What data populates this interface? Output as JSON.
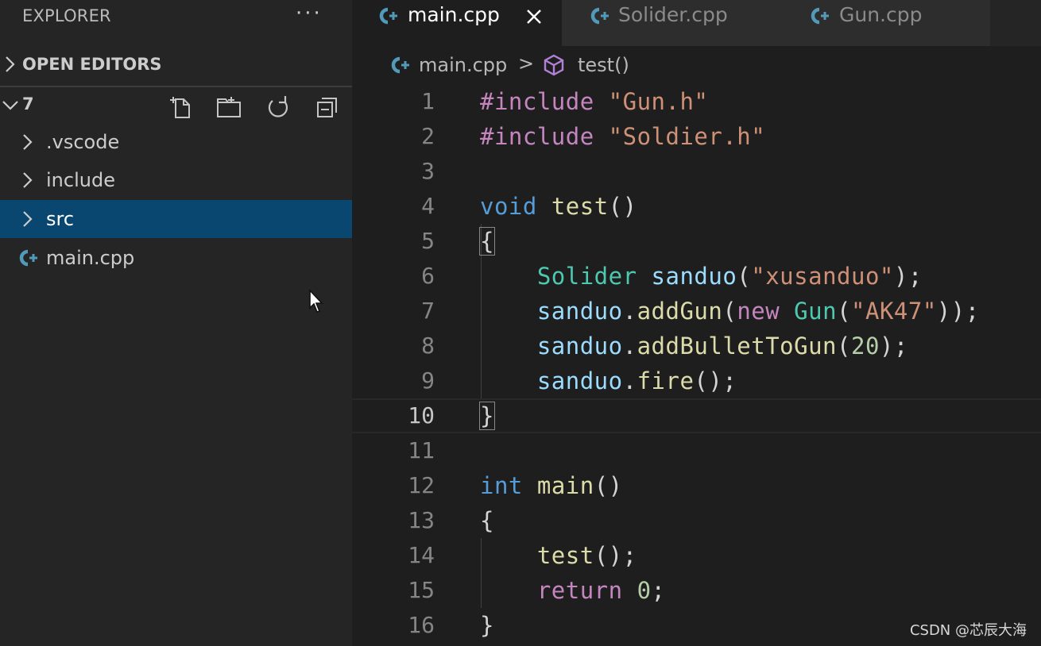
{
  "explorer": {
    "title": "EXPLORER",
    "more_label": "···",
    "open_editors_label": "OPEN EDITORS",
    "folder_name": "7",
    "tree": [
      {
        "label": ".vscode",
        "kind": "folder",
        "selected": false
      },
      {
        "label": "include",
        "kind": "folder",
        "selected": false
      },
      {
        "label": "src",
        "kind": "folder",
        "selected": true
      },
      {
        "label": "main.cpp",
        "kind": "file",
        "selected": false
      }
    ],
    "toolbar_icons": [
      "new-file-icon",
      "new-folder-icon",
      "refresh-icon",
      "collapse-all-icon"
    ]
  },
  "tabs": [
    {
      "label": "main.cpp",
      "active": true,
      "icon": "cpp-file-icon"
    },
    {
      "label": "Solider.cpp",
      "active": false,
      "icon": "cpp-file-icon"
    },
    {
      "label": "Gun.cpp",
      "active": false,
      "icon": "cpp-file-icon"
    }
  ],
  "breadcrumb": {
    "file": "main.cpp",
    "separator": ">",
    "symbol": "test()"
  },
  "editor": {
    "current_line": 10,
    "line_numbers": [
      "1",
      "2",
      "3",
      "4",
      "5",
      "6",
      "7",
      "8",
      "9",
      "10",
      "11",
      "12",
      "13",
      "14",
      "15",
      "16"
    ],
    "lines": [
      [
        [
          "pre",
          "#include"
        ],
        [
          "pun",
          " "
        ],
        [
          "str",
          "\"Gun.h\""
        ]
      ],
      [
        [
          "pre",
          "#include"
        ],
        [
          "pun",
          " "
        ],
        [
          "str",
          "\"Soldier.h\""
        ]
      ],
      [],
      [
        [
          "type",
          "void"
        ],
        [
          "pun",
          " "
        ],
        [
          "fn",
          "test"
        ],
        [
          "pun",
          "()"
        ]
      ],
      [
        [
          "bm",
          "{"
        ]
      ],
      [
        [
          "pun",
          "    "
        ],
        [
          "cls",
          "Solider"
        ],
        [
          "pun",
          " "
        ],
        [
          "var",
          "sanduo"
        ],
        [
          "pun",
          "("
        ],
        [
          "str",
          "\"xusanduo\""
        ],
        [
          "pun",
          ");"
        ]
      ],
      [
        [
          "pun",
          "    "
        ],
        [
          "var",
          "sanduo"
        ],
        [
          "pun",
          "."
        ],
        [
          "fn",
          "addGun"
        ],
        [
          "pun",
          "("
        ],
        [
          "ctl",
          "new"
        ],
        [
          "pun",
          " "
        ],
        [
          "cls",
          "Gun"
        ],
        [
          "pun",
          "("
        ],
        [
          "str",
          "\"AK47\""
        ],
        [
          "pun",
          "));"
        ]
      ],
      [
        [
          "pun",
          "    "
        ],
        [
          "var",
          "sanduo"
        ],
        [
          "pun",
          "."
        ],
        [
          "fn",
          "addBulletToGun"
        ],
        [
          "pun",
          "("
        ],
        [
          "num",
          "20"
        ],
        [
          "pun",
          ");"
        ]
      ],
      [
        [
          "pun",
          "    "
        ],
        [
          "var",
          "sanduo"
        ],
        [
          "pun",
          "."
        ],
        [
          "fn",
          "fire"
        ],
        [
          "pun",
          "();"
        ]
      ],
      [
        [
          "bm",
          "}"
        ]
      ],
      [],
      [
        [
          "type",
          "int"
        ],
        [
          "pun",
          " "
        ],
        [
          "fn",
          "main"
        ],
        [
          "pun",
          "()"
        ]
      ],
      [
        [
          "pun",
          "{"
        ]
      ],
      [
        [
          "pun",
          "    "
        ],
        [
          "fn",
          "test"
        ],
        [
          "pun",
          "();"
        ]
      ],
      [
        [
          "pun",
          "    "
        ],
        [
          "ctl",
          "return"
        ],
        [
          "pun",
          " "
        ],
        [
          "num",
          "0"
        ],
        [
          "pun",
          ";"
        ]
      ],
      [
        [
          "pun",
          "}"
        ]
      ]
    ]
  },
  "watermark": "CSDN @芯辰大海",
  "colors": {
    "sidebar_bg": "#252526",
    "editor_bg": "#1e1e1e",
    "selection_bg": "#094771",
    "cpp_icon": "#519aba",
    "symbol_icon": "#b180d7"
  }
}
